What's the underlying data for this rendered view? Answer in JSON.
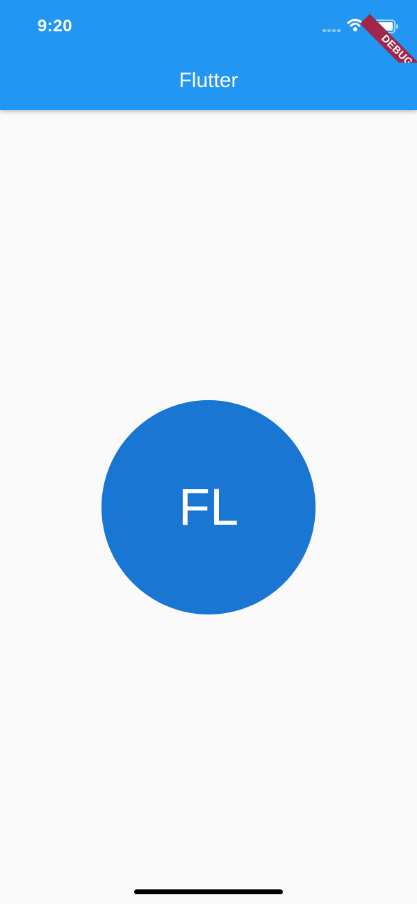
{
  "status_bar": {
    "time": "9:20",
    "icons": [
      "signal-dots-icon",
      "wifi-icon",
      "battery-icon"
    ]
  },
  "app_bar": {
    "title": "Flutter",
    "background_color": "#2196f3"
  },
  "debug_banner": {
    "label": "DEBUG",
    "color": "#a0274a"
  },
  "avatar": {
    "initials": "FL",
    "background_color": "#1976d2"
  },
  "home_indicator": {
    "icon": "home-indicator-bar"
  }
}
